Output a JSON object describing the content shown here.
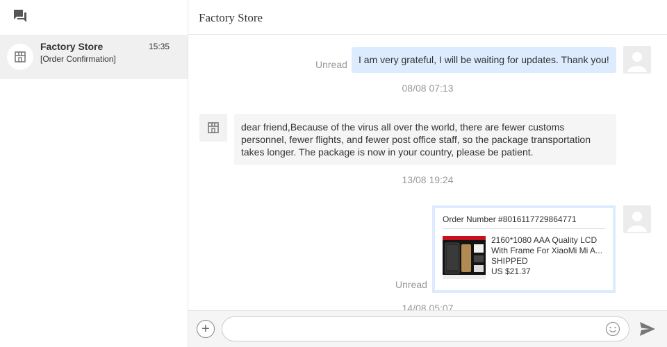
{
  "sidebar": {
    "icon": "chat-icon",
    "conversation": {
      "name": "Factory Store",
      "time": "15:35",
      "preview": "[Order Confirmation]",
      "avatar_icon": "store-icon"
    }
  },
  "chat": {
    "title": "Factory Store",
    "messages": {
      "m1": {
        "text": "I am very grateful, I will be waiting for updates. Thank you!",
        "status": "Unread"
      },
      "ts1": "08/08 07:13",
      "m2": {
        "line1": "dear friend,Because of the virus all over the world, there are fewer customs",
        "line2": "personnel, fewer flights, and fewer post office staff, so the package transportation",
        "line3": "takes longer. The package is now in your country, please be patient."
      },
      "ts2": "13/08 19:24",
      "order": {
        "number": "Order Number #8016117729864771",
        "title_line1": "2160*1080 AAA Quality LCD",
        "title_line2": "With Frame For XiaoMi Mi A...",
        "status": "SHIPPED",
        "price": "US $21.37",
        "read_status": "Unread"
      },
      "ts3": "14/08 05:07"
    }
  },
  "composer": {
    "placeholder": "",
    "add_icon": "plus-icon",
    "emoji_icon": "emoji-icon",
    "send_icon": "send-icon"
  },
  "colors": {
    "outgoing_bubble": "#dcebfd",
    "incoming_bubble": "#f5f5f5",
    "selected_conversation": "#f0f0f0",
    "muted_text": "#999999"
  }
}
